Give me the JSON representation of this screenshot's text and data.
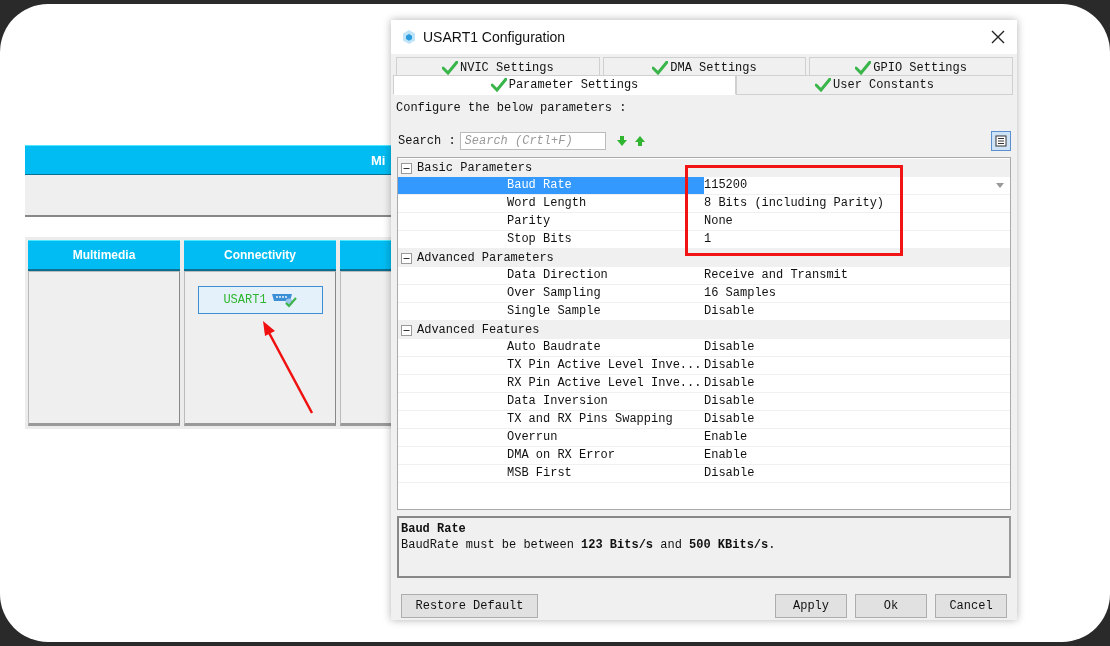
{
  "background_app": {
    "header": "Mi",
    "categories": [
      {
        "title": "Multimedia"
      },
      {
        "title": "Connectivity",
        "peripherals": [
          {
            "label": "USART1"
          }
        ]
      }
    ]
  },
  "dialog": {
    "title": "USART1 Configuration",
    "tabs_back": [
      {
        "label": "NVIC Settings",
        "selected": false
      },
      {
        "label": "DMA Settings",
        "selected": false
      },
      {
        "label": "GPIO Settings",
        "selected": false
      }
    ],
    "tabs_front": [
      {
        "label": "Parameter Settings",
        "selected": true
      },
      {
        "label": "User Constants",
        "selected": false
      }
    ],
    "intro": "Configure the below parameters :",
    "search": {
      "label": "Search :",
      "placeholder": "Search (Crtl+F)"
    },
    "parameters": [
      {
        "group": "Basic Parameters",
        "expanded": true,
        "children": [
          {
            "name": "Baud Rate",
            "value": "115200",
            "selected": true
          },
          {
            "name": "Word Length",
            "value": "8 Bits (including Parity)",
            "selected": false
          },
          {
            "name": "Parity",
            "value": "None",
            "selected": false
          },
          {
            "name": "Stop Bits",
            "value": "1",
            "selected": false
          }
        ]
      },
      {
        "group": "Advanced Parameters",
        "expanded": true,
        "children": [
          {
            "name": "Data Direction",
            "value": "Receive and Transmit",
            "selected": false
          },
          {
            "name": "Over Sampling",
            "value": "16 Samples",
            "selected": false
          },
          {
            "name": "Single Sample",
            "value": "Disable",
            "selected": false
          }
        ]
      },
      {
        "group": "Advanced Features",
        "expanded": true,
        "children": [
          {
            "name": "Auto Baudrate",
            "value": "Disable",
            "selected": false
          },
          {
            "name": "TX Pin Active Level Inve...",
            "value": "Disable",
            "selected": false
          },
          {
            "name": "RX Pin Active Level Inve...",
            "value": "Disable",
            "selected": false
          },
          {
            "name": "Data Inversion",
            "value": "Disable",
            "selected": false
          },
          {
            "name": "TX and RX Pins Swapping",
            "value": "Disable",
            "selected": false
          },
          {
            "name": "Overrun",
            "value": "Enable",
            "selected": false
          },
          {
            "name": "DMA on RX Error",
            "value": "Enable",
            "selected": false
          },
          {
            "name": "MSB First",
            "value": "Disable",
            "selected": false
          }
        ]
      }
    ],
    "description": {
      "title": "Baud Rate",
      "text": "BaudRate must be between **123 Bits/s** and **500 KBits/s**."
    },
    "buttons": [
      "Restore Default",
      "Apply",
      "Ok",
      "Cancel"
    ]
  }
}
